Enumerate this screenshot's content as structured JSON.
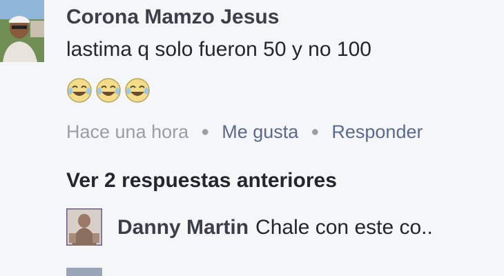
{
  "comment": {
    "author": "Corona Mamzo Jesus",
    "text": "lastima q solo fueron 50 y no 100",
    "emojis": [
      "crying-laughing-emoji",
      "crying-laughing-emoji",
      "crying-laughing-emoji"
    ],
    "time": "Hace una hora",
    "like_label": "Me gusta",
    "reply_label": "Responder"
  },
  "replies": {
    "view_previous_label": "Ver 2 respuestas anteriores",
    "items": [
      {
        "author": "Danny Martin",
        "text": "Chale con este co.."
      }
    ]
  },
  "colors": {
    "background": "#f5f6f8",
    "author": "#3b3f4a",
    "link": "#5b6a8c",
    "muted": "#9a9ea6"
  }
}
